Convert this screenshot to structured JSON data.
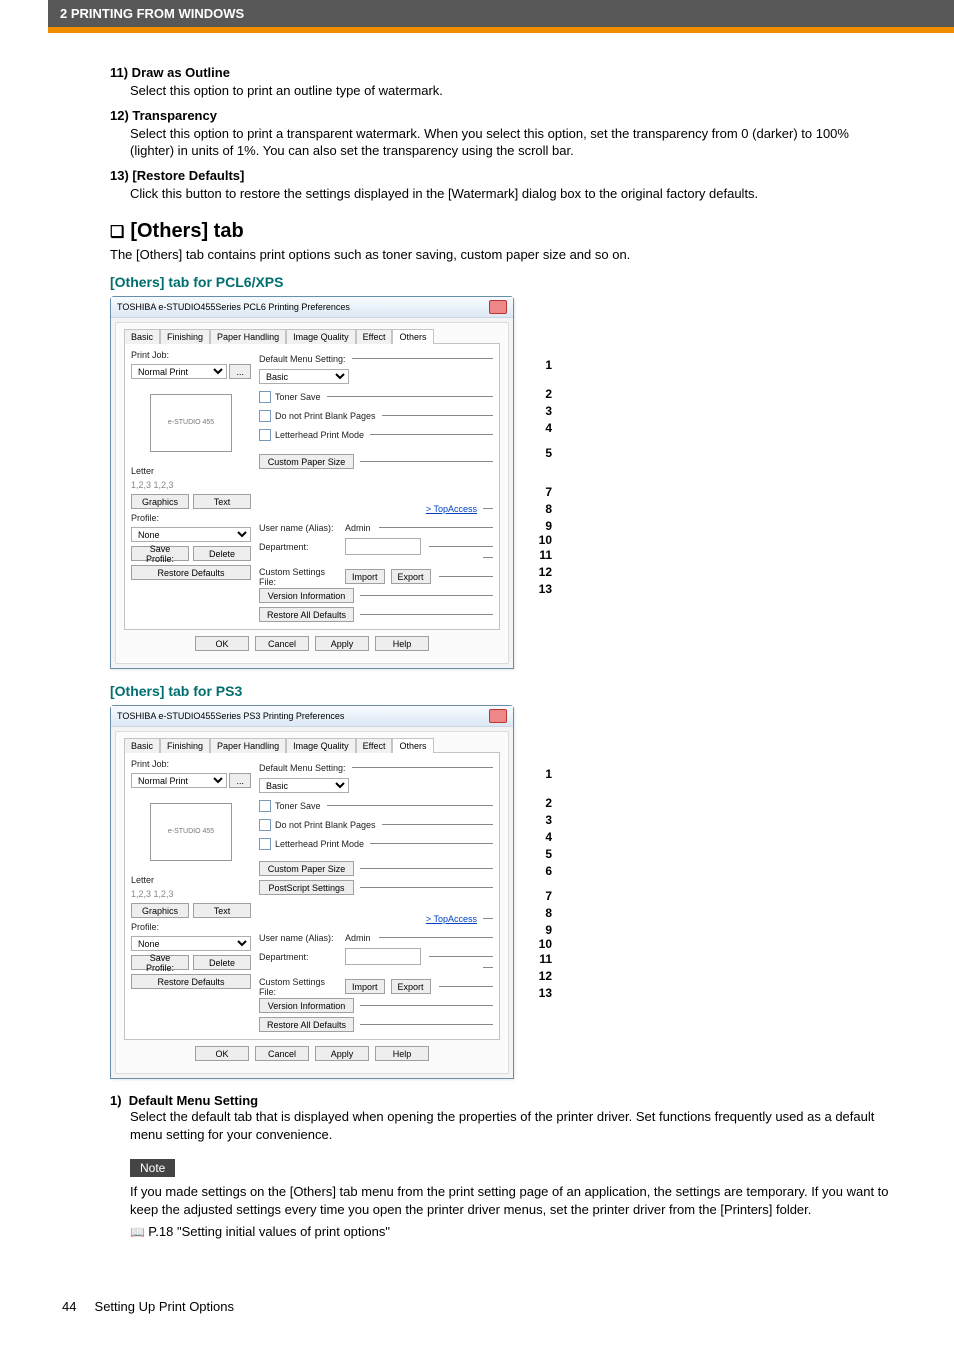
{
  "header": {
    "breadcrumb": "2 PRINTING FROM WINDOWS"
  },
  "items": {
    "11": {
      "title": "11) Draw as Outline",
      "body": "Select this option to print an outline type of watermark."
    },
    "12": {
      "title": "12) Transparency",
      "body": "Select this option to print a transparent watermark. When you select this option, set the transparency from 0 (darker) to 100% (lighter) in units of 1%. You can also set the transparency using the scroll bar."
    },
    "13": {
      "title": "13) [Restore Defaults]",
      "body": "Click this button to restore the settings displayed in the [Watermark] dialog box to the original factory defaults."
    }
  },
  "section": {
    "title": "[Others] tab",
    "intro": "The [Others] tab contains print options such as toner saving, custom paper size and so on."
  },
  "sub1": "[Others] tab for PCL6/XPS",
  "sub2": "[Others] tab for PS3",
  "dialog1": {
    "title": "TOSHIBA e-STUDIO455Series PCL6 Printing Preferences",
    "tabs": [
      "Basic",
      "Finishing",
      "Paper Handling",
      "Image Quality",
      "Effect",
      "Others"
    ],
    "printjob_label": "Print Job:",
    "printjob_value": "Normal Print",
    "default_menu": "Default Menu Setting:",
    "default_menu_value": "Basic",
    "toner": "Toner Save",
    "blank": "Do not Print Blank Pages",
    "letterhead": "Letterhead Print Mode",
    "custompaper": "Custom Paper Size",
    "letter": "Letter",
    "top": "> TopAccess",
    "user_label": "User name (Alias):",
    "user_value": "Admin",
    "dept": "Department:",
    "custfile": "Custom Settings File:",
    "import": "Import",
    "export": "Export",
    "verinfo": "Version Information",
    "restoreall": "Restore All Defaults",
    "graphics": "Graphics",
    "text": "Text",
    "profile": "Profile:",
    "profile_value": "None",
    "save_profile": "Save Profile:",
    "delete": "Delete",
    "restore_defaults": "Restore Defaults",
    "ok": "OK",
    "cancel": "Cancel",
    "apply": "Apply",
    "help": "Help",
    "page_nums": "1,2,3    1,2,3"
  },
  "dialog2": {
    "title": "TOSHIBA e-STUDIO455Series PS3 Printing Preferences",
    "ps_settings": "PostScript Settings"
  },
  "def_item": {
    "n": "1)",
    "title": "Default Menu Setting",
    "body": "Select the default tab that is displayed when opening the properties of the printer driver. Set functions frequently used as a default menu setting for your convenience."
  },
  "note": {
    "label": "Note",
    "body": "If you made settings on the [Others] tab menu from the print setting page of an application, the settings are temporary. If you want to keep the adjusted settings every time you open the printer driver menus, set the printer driver from the [Printers] folder.",
    "link": "P.18 \"Setting initial values of print options\""
  },
  "footer": {
    "page": "44",
    "title": "Setting Up Print Options"
  },
  "callouts1": [
    "1",
    "2",
    "3",
    "4",
    "5",
    "7",
    "8",
    "9",
    "10",
    "11",
    "12",
    "13"
  ],
  "callouts2": [
    "1",
    "2",
    "3",
    "4",
    "5",
    "6",
    "7",
    "8",
    "9",
    "10",
    "11",
    "12",
    "13"
  ]
}
